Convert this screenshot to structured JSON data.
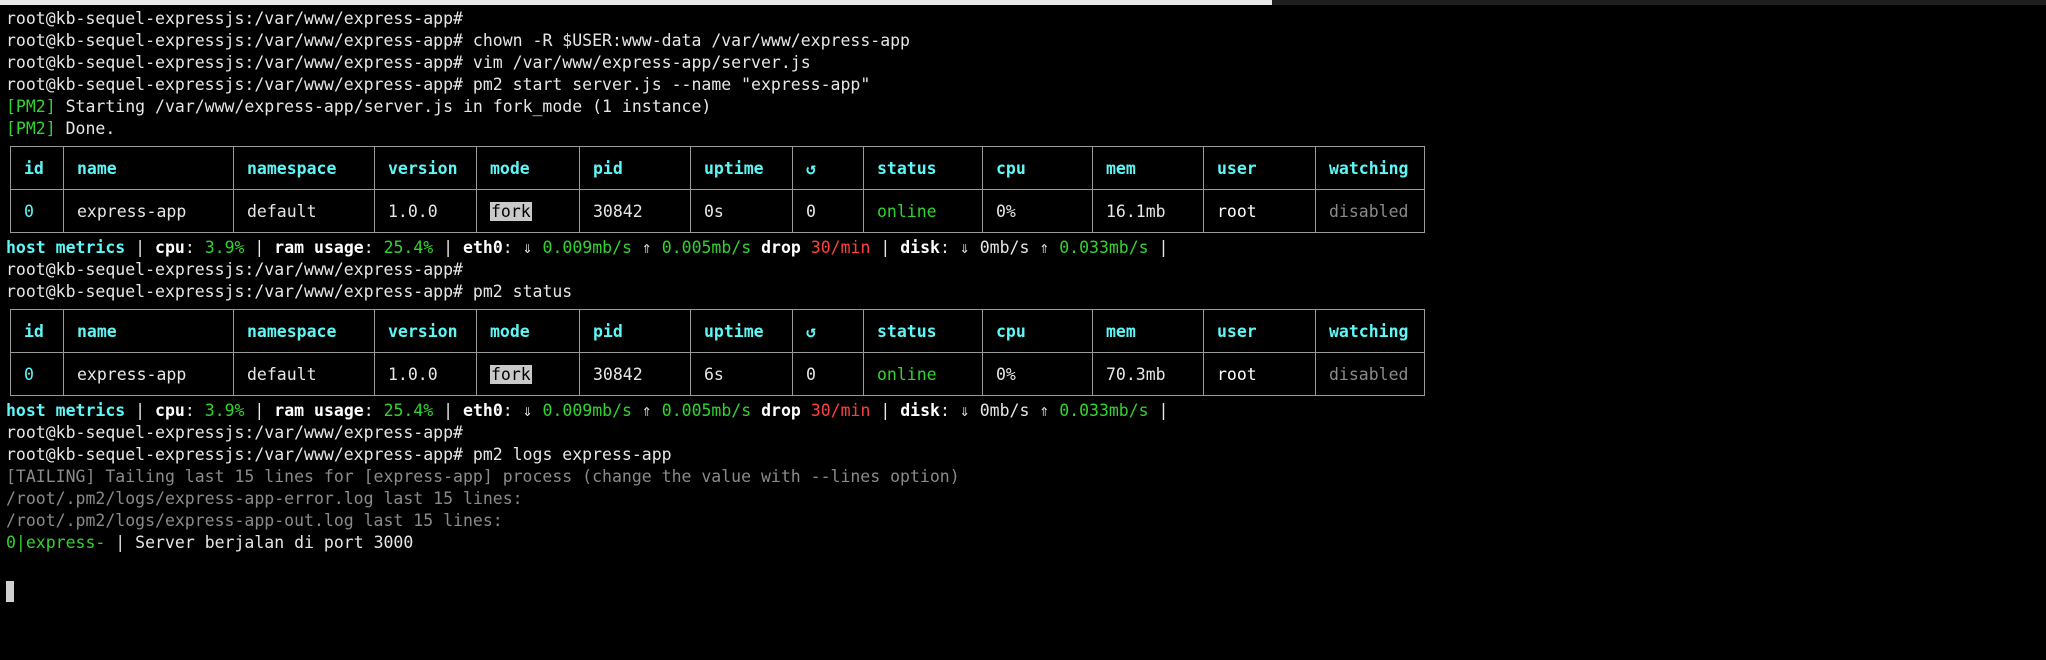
{
  "prompt": "root@kb-sequel-expressjs:/var/www/express-app#",
  "commands": {
    "chown": "chown -R $USER:www-data /var/www/express-app",
    "vim": "vim /var/www/express-app/server.js",
    "start": "pm2 start server.js --name \"express-app\"",
    "status": "pm2 status",
    "logs": "pm2 logs express-app"
  },
  "pm2_output": {
    "tag": "[PM2]",
    "starting": "Starting /var/www/express-app/server.js in fork_mode (1 instance)",
    "done": "Done."
  },
  "table_headers": [
    "id",
    "name",
    "namespace",
    "version",
    "mode",
    "pid",
    "uptime",
    "↺",
    "status",
    "cpu",
    "mem",
    "user",
    "watching"
  ],
  "table1_row": {
    "id": "0",
    "name": "express-app",
    "namespace": "default",
    "version": "1.0.0",
    "mode": "fork",
    "pid": "30842",
    "uptime": "0s",
    "restarts": "0",
    "status": "online",
    "cpu": "0%",
    "mem": "16.1mb",
    "user": "root",
    "watching": "disabled"
  },
  "table2_row": {
    "id": "0",
    "name": "express-app",
    "namespace": "default",
    "version": "1.0.0",
    "mode": "fork",
    "pid": "30842",
    "uptime": "6s",
    "restarts": "0",
    "status": "online",
    "cpu": "0%",
    "mem": "70.3mb",
    "user": "root",
    "watching": "disabled"
  },
  "metrics": {
    "label": "host metrics",
    "sep": "|",
    "cpu_label": "cpu",
    "cpu": "3.9%",
    "ram_label": "ram usage",
    "ram": "25.4%",
    "eth_label": "eth0",
    "down_arrow": "⇓",
    "up_arrow": "⇑",
    "eth_down": "0.009mb/s",
    "eth_up": "0.005mb/s",
    "drop_label": "drop",
    "drop": "30/min",
    "disk_label": "disk",
    "disk_down": "0mb/s",
    "disk_up": "0.033mb/s"
  },
  "logs": {
    "tailing": "[TAILING] Tailing last 15 lines for [express-app] process (change the value with --lines option)",
    "error_log": "/root/.pm2/logs/express-app-error.log last 15 lines:",
    "out_log": "/root/.pm2/logs/express-app-out.log last 15 lines:",
    "app_prefix": "0|express-",
    "pipe": "|",
    "message": "Server berjalan di port 3000"
  }
}
